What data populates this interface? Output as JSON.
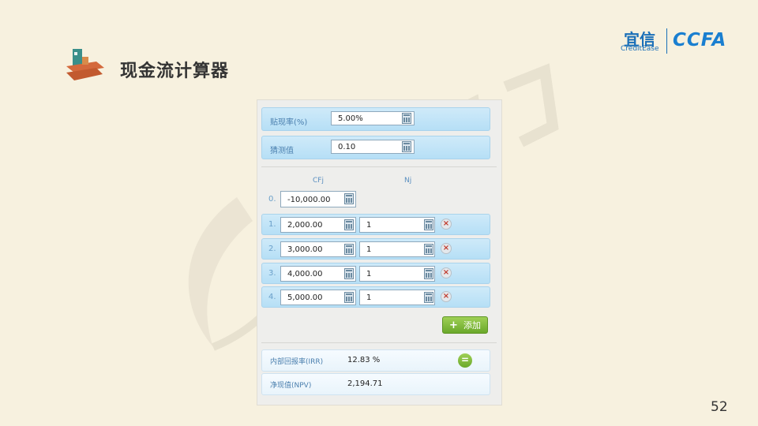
{
  "page": {
    "title": "现金流计算器",
    "page_number": "52"
  },
  "brand": {
    "name_cn": "宜信",
    "name_en": "CreditEase",
    "partner": "CCFA"
  },
  "calculator": {
    "discount_rate": {
      "label": "贴现率(%)",
      "value": "5.00%"
    },
    "guess": {
      "label": "猜测值",
      "value": "0.10"
    },
    "columns": {
      "cf": "CFj",
      "n": "Nj"
    },
    "cashflows": [
      {
        "index": "0.",
        "cf": "-10,000.00"
      },
      {
        "index": "1.",
        "cf": "2,000.00",
        "n": "1"
      },
      {
        "index": "2.",
        "cf": "3,000.00",
        "n": "1"
      },
      {
        "index": "3.",
        "cf": "4,000.00",
        "n": "1"
      },
      {
        "index": "4.",
        "cf": "5,000.00",
        "n": "1"
      }
    ],
    "add_label": "添加",
    "irr": {
      "label": "内部回报率(IRR)",
      "value": "12.83 %"
    },
    "npv": {
      "label": "净现值(NPV)",
      "value": "2,194.71"
    }
  }
}
